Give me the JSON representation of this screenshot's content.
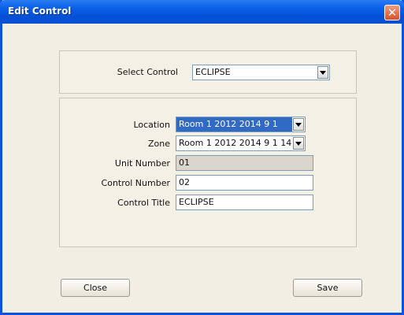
{
  "window": {
    "title": "Edit Control"
  },
  "select_section": {
    "label": "Select Control",
    "value": "ECLIPSE"
  },
  "details": {
    "location": {
      "label": "Location",
      "value": "Room 1 2012 2014 9 1"
    },
    "zone": {
      "label": "Zone",
      "value": "Room 1 2012 2014 9 1 14"
    },
    "unit_number": {
      "label": "Unit Number",
      "value": "01"
    },
    "control_number": {
      "label": "Control Number",
      "value": "02"
    },
    "control_title": {
      "label": "Control Title",
      "value": "ECLIPSE"
    }
  },
  "buttons": {
    "close": "Close",
    "save": "Save"
  },
  "colors": {
    "title_bar": "#0a5fe8",
    "selection": "#316ac5",
    "dialog_bg": "#f1efe3"
  }
}
